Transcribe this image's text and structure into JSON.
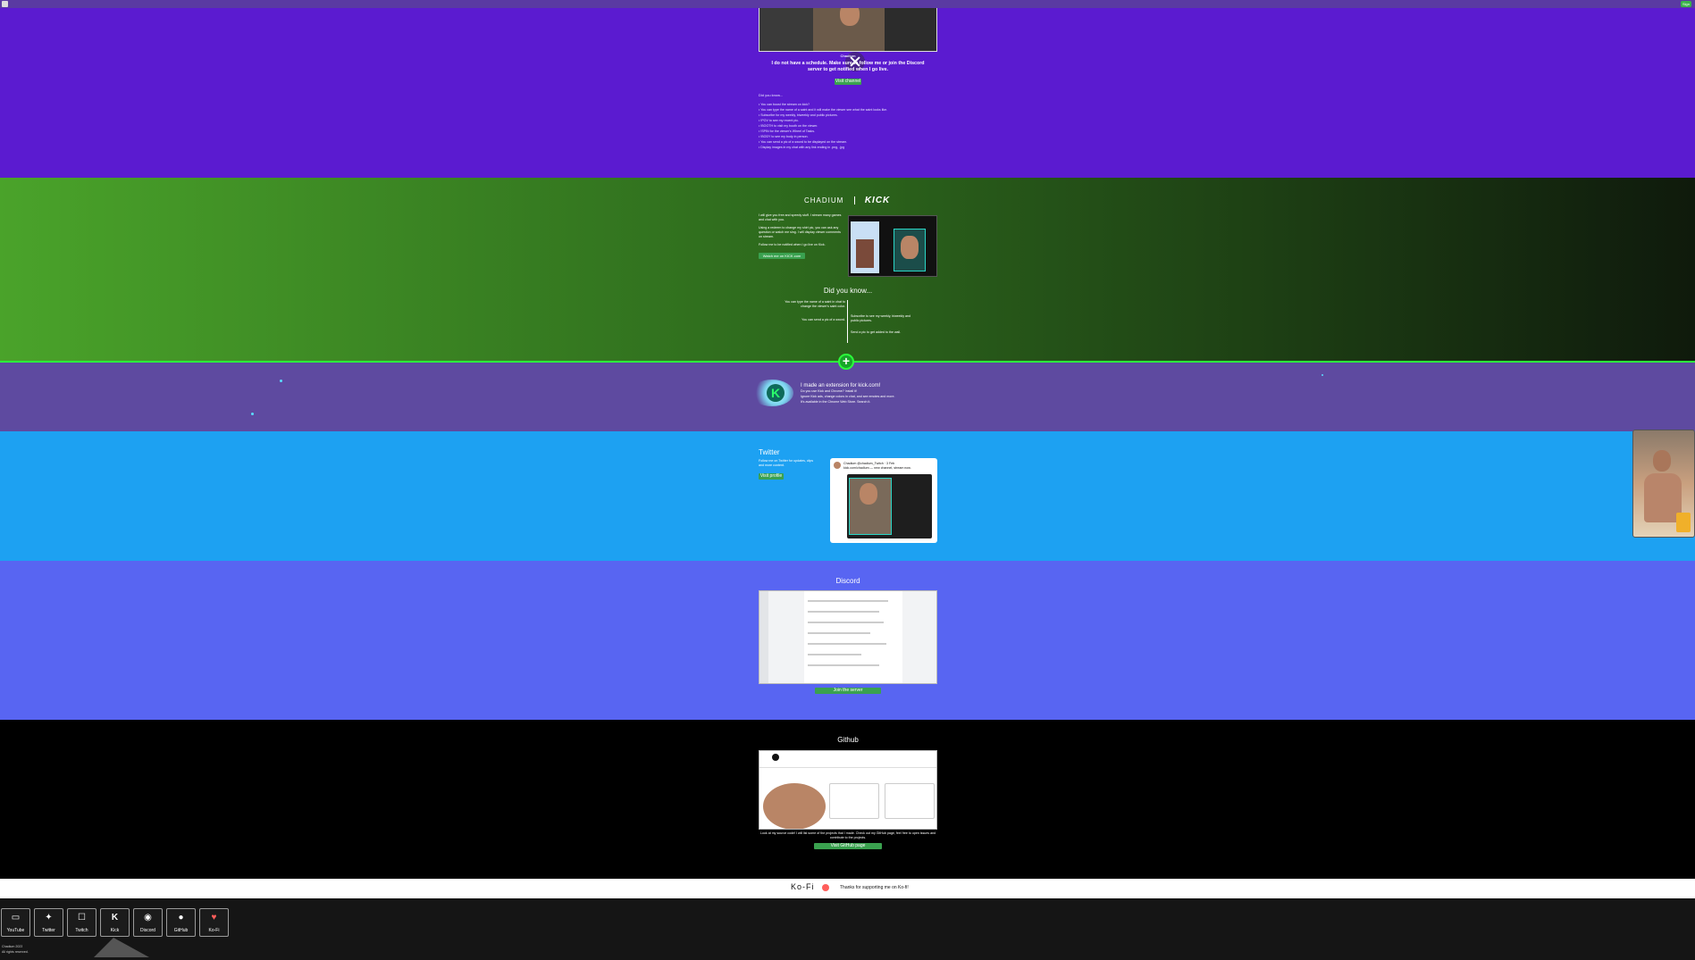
{
  "top": {
    "badge": "Sign"
  },
  "purple": {
    "caption_small": "Chadium",
    "intro_line1": "I do not have a schedule. Make sure to follow me or join the Discord",
    "intro_line2": "server to get notified when I go live.",
    "button": "Visit channel",
    "list_title": "Did you know...",
    "items": [
      "• You can boost the stream on kick?",
      "• You can type the name of a saint and it will make the viewer see what the saint looks like.",
      "• Subscribe for my weekly, biweekly and public pictures.",
      "• !POV to see my recent pic.",
      "• !BOOTH to visit my booth on the viewer.",
      "• !SPIN for the viewer's Wheel of Tasks.",
      "• !BODY to see my body in person.",
      "• You can send a pic of a sword to be displayed on the stream.",
      "• Display images in my chat with any link ending in .png, .jpg"
    ]
  },
  "kick": {
    "brand_left": "CHADIUM",
    "brand_right": "KICK",
    "p1": "I will give you free and speedy stuff. I stream many games and chat with you.",
    "p2": "Using a redeem to change my shirt pic, you can ask any question or watch me sing. I will display viewer comments on stream.",
    "p3": "Follow me to be notified when I go live on Kick.",
    "button": "Watch me on KICK.com",
    "did_title": "Did you know...",
    "left_items": [
      "You can type the name of a saint in chat to change the viewer's saint color.",
      "You can send a pic of a sword."
    ],
    "right_items": [
      "Subscribe to see my weekly, biweekly and public pictures.",
      "Send a pic to get added to the wall."
    ]
  },
  "extension": {
    "title": "I made an extension for kick.com!",
    "sub": "Do you use Kick and Chrome? Install it!",
    "line1": "Ignore Kick ads, change colors in chat, and see emotes and more.",
    "line2": "It's available in the Chrome Web Store. Search it."
  },
  "twitter": {
    "title": "Twitter",
    "text1": "Follow me on Twitter for updates, clips",
    "text2": "and more content.",
    "button": "Visit profile",
    "tweet_name": "Chadium @chadium_Twitch · 3 Feb",
    "tweet_text": "kick.com/chadium — new channel, stream now."
  },
  "discord": {
    "title": "Discord",
    "button": "Join the server"
  },
  "github": {
    "title": "Github",
    "desc": "Look at my source code! I will list some of the projects that I made. Check out my GitHub page, feel free to open issues and contribute to the projects.",
    "button": "Visit GitHub page"
  },
  "kofi": {
    "brand": "Ko-Fi",
    "message": "Thanks for supporting me on Ko-fi!"
  },
  "footer": {
    "socials": [
      "YouTube",
      "Twitter",
      "Twitch",
      "Kick",
      "Discord",
      "GitHub",
      "Ko-Fi"
    ],
    "line1": "Chadium 2023",
    "line2": "All rights reserved."
  }
}
